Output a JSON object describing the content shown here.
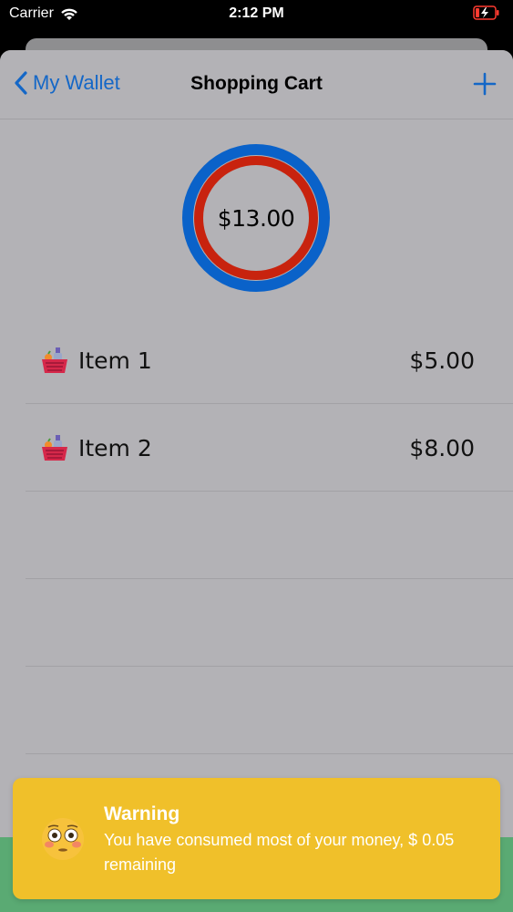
{
  "status_bar": {
    "carrier": "Carrier",
    "time": "2:12 PM"
  },
  "nav": {
    "back_label": "My Wallet",
    "title": "Shopping Cart"
  },
  "total": {
    "amount": "$13.00"
  },
  "items": [
    {
      "name": "Item 1",
      "price": "$5.00",
      "icon": "basket-icon"
    },
    {
      "name": "Item 2",
      "price": "$8.00",
      "icon": "basket-icon"
    }
  ],
  "toast": {
    "title": "Warning",
    "message": "You have consumed most of your money, $ 0.05 remaining",
    "icon": "flushed-face-emoji"
  },
  "colors": {
    "accent": "#1467c7",
    "ring_outer": "#0a62c9",
    "ring_inner": "#c8230e",
    "toast_bg": "#f0c02a",
    "sheet_bg": "#b3b2b6"
  }
}
